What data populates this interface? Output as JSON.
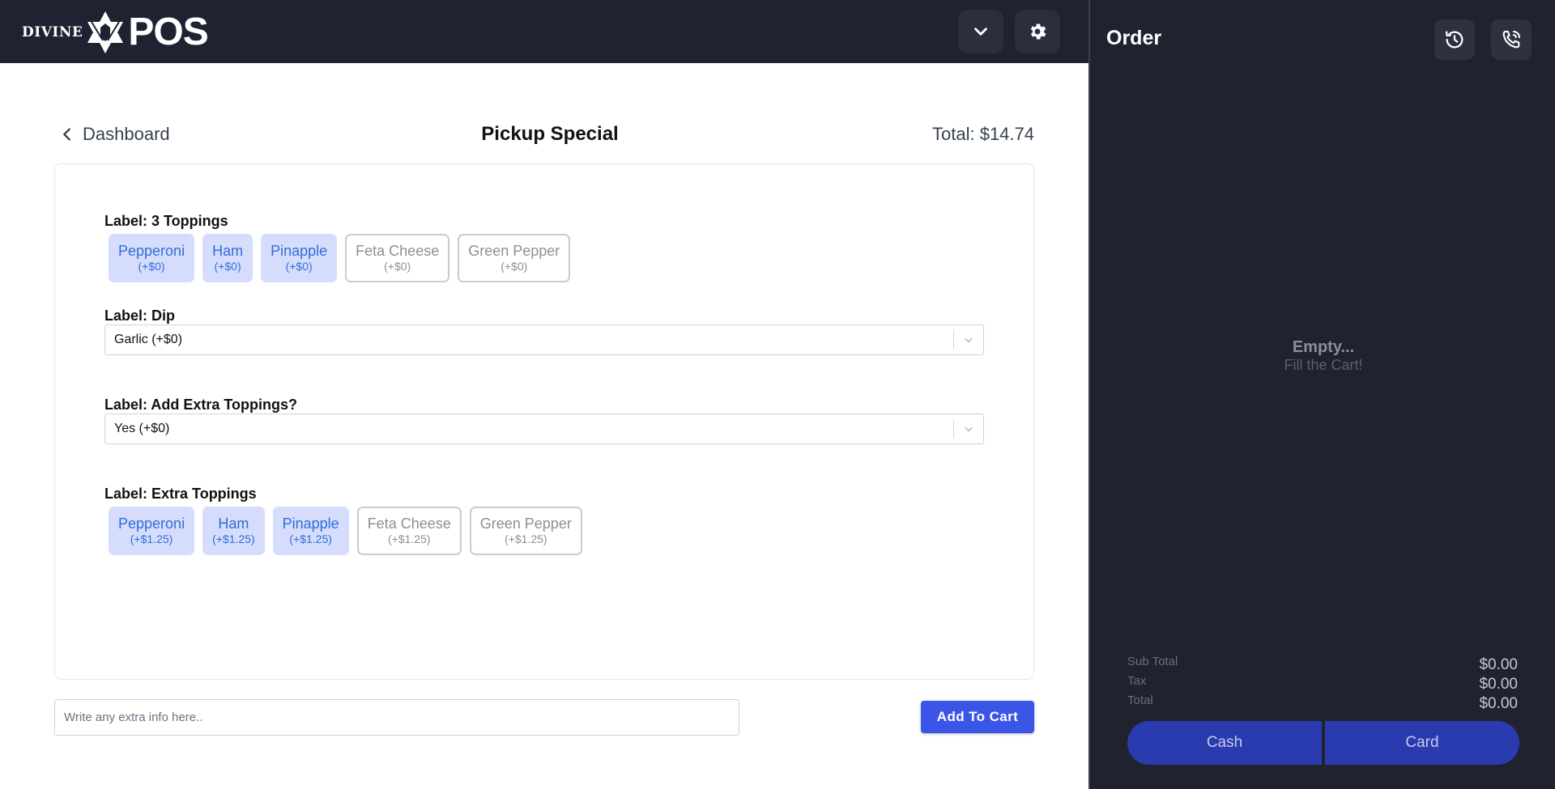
{
  "brand": {
    "small": "DIVINE",
    "big": "POS"
  },
  "header": {
    "dropdown_icon": "chevron-down-icon",
    "settings_icon": "gear-icon"
  },
  "page": {
    "back_label": "Dashboard",
    "title": "Pickup Special",
    "total": "Total: $14.74"
  },
  "groups": [
    {
      "label": "Label: 3 Toppings",
      "options": [
        {
          "name": "Pepperoni",
          "price": "(+$0)",
          "selected": true
        },
        {
          "name": "Ham",
          "price": "(+$0)",
          "selected": true
        },
        {
          "name": "Pinapple",
          "price": "(+$0)",
          "selected": true
        },
        {
          "name": "Feta Cheese",
          "price": "(+$0)",
          "selected": false
        },
        {
          "name": "Green Pepper",
          "price": "(+$0)",
          "selected": false
        }
      ]
    },
    {
      "label": "Label: Dip",
      "value": "Garlic (+$0)"
    },
    {
      "label": "Label: Add Extra Toppings?",
      "value": "Yes (+$0)"
    },
    {
      "label": "Label: Extra Toppings",
      "options": [
        {
          "name": "Pepperoni",
          "price": "(+$1.25)",
          "selected": true
        },
        {
          "name": "Ham",
          "price": "(+$1.25)",
          "selected": true
        },
        {
          "name": "Pinapple",
          "price": "(+$1.25)",
          "selected": true
        },
        {
          "name": "Feta Cheese",
          "price": "(+$1.25)",
          "selected": false
        },
        {
          "name": "Green Pepper",
          "price": "(+$1.25)",
          "selected": false
        }
      ]
    }
  ],
  "extra_info": {
    "placeholder": "Write any extra info here..",
    "value": ""
  },
  "add_to_cart_label": "Add To Cart",
  "order": {
    "title": "Order",
    "history_icon": "history-icon",
    "phone_icon": "phone-call-icon",
    "empty_title": "Empty...",
    "empty_subtitle": "Fill the Cart!",
    "subtotal_label": "Sub Total",
    "subtotal": "$0.00",
    "tax_label": "Tax",
    "tax": "$0.00",
    "total_label": "Total",
    "total": "$0.00",
    "cash_label": "Cash",
    "card_label": "Card"
  },
  "colors": {
    "topbar": "#1f2230",
    "order_panel": "#20222f",
    "chip_selected_bg": "#d6dcfc",
    "chip_selected_text": "#2f6fdb",
    "primary_button": "#3b55e6",
    "pay_button": "#2a3bb0"
  }
}
